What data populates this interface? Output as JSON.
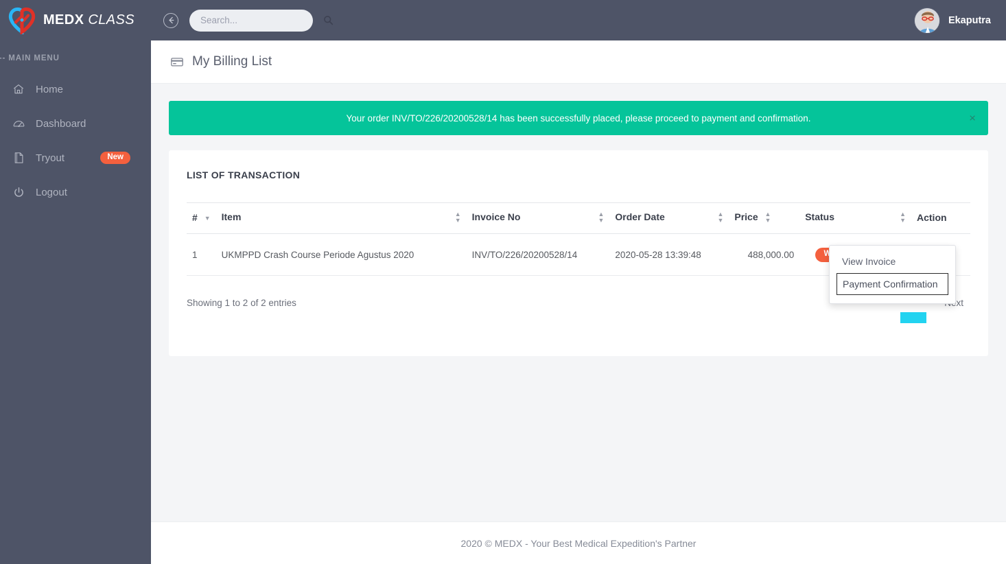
{
  "brand": {
    "name_bold": "MEDX",
    "name_light": "CLASS",
    "logo_icon": "heart-logo-icon",
    "colors": {
      "blue": "#29b6f6",
      "red": "#e03127"
    }
  },
  "topbar": {
    "back_icon": "back-arrow-circle-icon",
    "search": {
      "placeholder": "Search...",
      "value": "",
      "icon": "search-icon"
    },
    "user": {
      "name": "Ekaputra",
      "avatar_icon": "user-avatar"
    },
    "background": "#4e5467"
  },
  "sidebar": {
    "section_title": "--- MAIN MENU",
    "items": [
      {
        "label": "Home",
        "icon": "home-icon",
        "badge": null
      },
      {
        "label": "Dashboard",
        "icon": "speedometer-icon",
        "badge": null
      },
      {
        "label": "Tryout",
        "icon": "file-document-icon",
        "badge": "New"
      },
      {
        "label": "Logout",
        "icon": "power-icon",
        "badge": null
      }
    ],
    "badge_color": "#f4603e"
  },
  "page": {
    "title": "My Billing List",
    "title_icon": "credit-card-icon"
  },
  "alert": {
    "message": "Your order INV/TO/226/20200528/14 has been successfully placed, please proceed to payment and confirmation.",
    "close_label": "×",
    "color": "#05c49a"
  },
  "card": {
    "title": "LIST OF TRANSACTION"
  },
  "table": {
    "columns": [
      {
        "label": "#",
        "sortable": true,
        "align": "left"
      },
      {
        "label": "Item",
        "sortable": true,
        "align": "left"
      },
      {
        "label": "Invoice No",
        "sortable": true,
        "align": "left"
      },
      {
        "label": "Order Date",
        "sortable": true,
        "align": "left"
      },
      {
        "label": "Price",
        "sortable": true,
        "align": "right"
      },
      {
        "label": "Status",
        "sortable": true,
        "align": "center"
      },
      {
        "label": "Action",
        "sortable": false,
        "align": "center"
      }
    ],
    "rows": [
      {
        "num": "1",
        "item": "UKMPPD Crash Course Periode Agustus 2020",
        "invoice_no": "INV/TO/226/20200528/14",
        "order_date": "2020-05-28 13:39:48",
        "price": "488,000.00",
        "status": "Waiting Payment",
        "action_icon": "hamburger-menu-icon"
      }
    ],
    "status_color": "#f4603e"
  },
  "dropdown": {
    "items": [
      {
        "label": "View Invoice",
        "focused": false
      },
      {
        "label": "Payment Confirmation",
        "focused": true
      }
    ]
  },
  "table_footer": {
    "showing": "Showing 1 to 2 of 2 entries",
    "pager": {
      "next_label": "Next",
      "active_color": "#22d3f0"
    }
  },
  "footer": {
    "text": "2020 © MEDX - Your Best Medical Expedition's Partner"
  }
}
